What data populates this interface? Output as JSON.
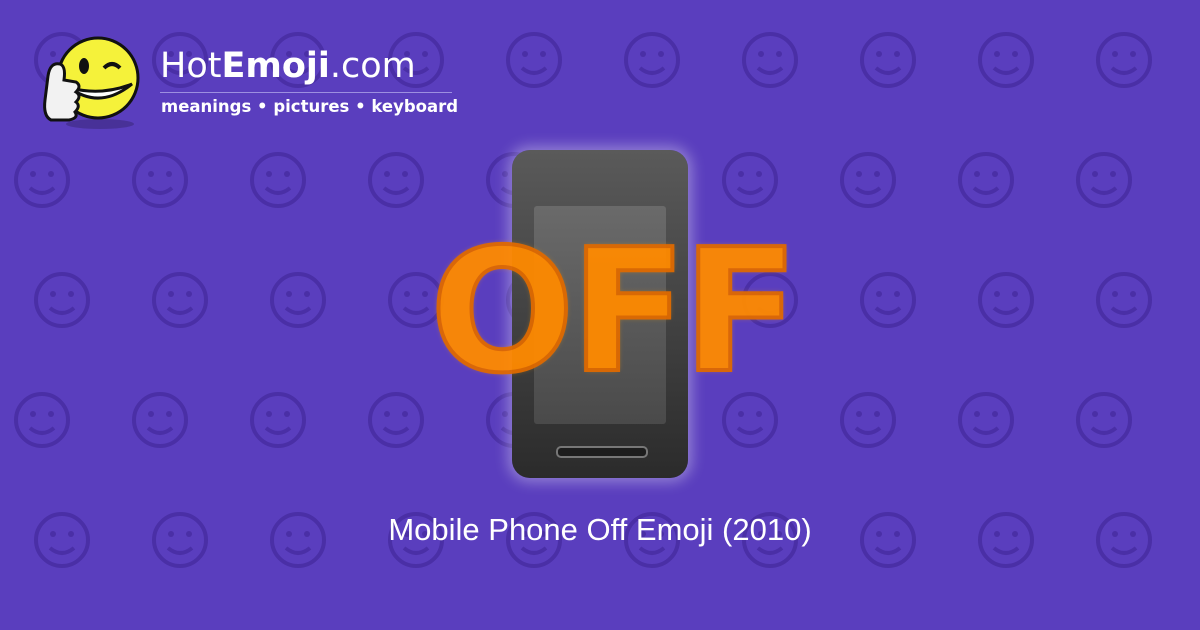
{
  "brand": {
    "prefix": "Hot",
    "bold": "Emoji",
    "suffix": ".com",
    "tagline": "meanings • pictures • keyboard"
  },
  "emoji": {
    "overlay_text": "OFF",
    "accent": "#ff8a00"
  },
  "caption": "Mobile Phone Off Emoji (2010)",
  "colors": {
    "background": "#5a3ebe",
    "pattern": "#4a2fa6"
  }
}
